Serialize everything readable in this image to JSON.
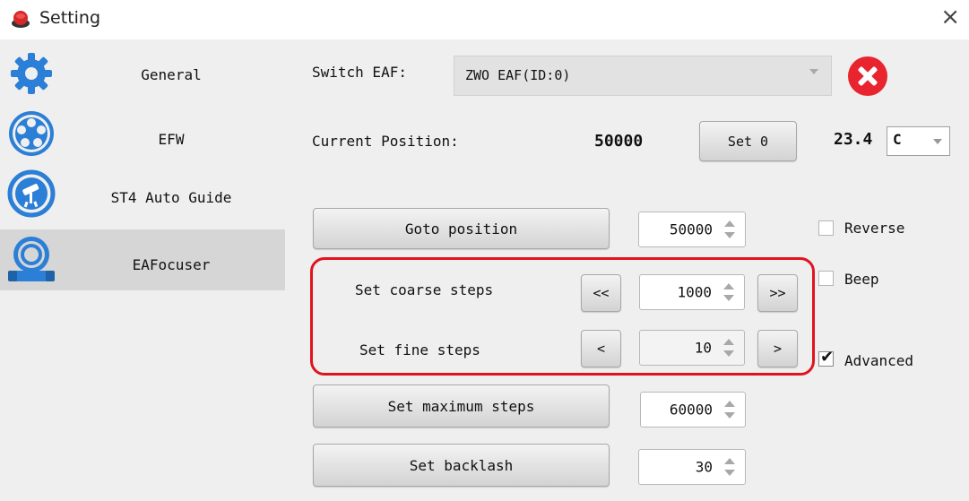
{
  "window": {
    "title": "Setting",
    "close_glyph": "×"
  },
  "sidebar": {
    "items": [
      {
        "label": "General",
        "icon": "gear-icon"
      },
      {
        "label": "EFW",
        "icon": "filter-wheel-icon"
      },
      {
        "label": "ST4 Auto Guide",
        "icon": "telescope-icon"
      },
      {
        "label": "EAFocuser",
        "icon": "focuser-icon",
        "active": true
      }
    ]
  },
  "eaf": {
    "switch_label": "Switch EAF:",
    "device_value": "ZWO EAF(ID:0)",
    "current_position_label": "Current Position:",
    "current_position_value": "50000",
    "set0_label": "Set 0",
    "temperature_value": "23.4",
    "temperature_unit": "C",
    "goto_label": "Goto position",
    "goto_value": "50000",
    "coarse_label": "Set coarse steps",
    "coarse_dec": "<<",
    "coarse_value": "1000",
    "coarse_inc": ">>",
    "fine_label": "Set fine steps",
    "fine_dec": "<",
    "fine_value": "10",
    "fine_inc": ">",
    "max_label": "Set maximum steps",
    "max_value": "60000",
    "backlash_label": "Set backlash",
    "backlash_value": "30",
    "reverse_label": "Reverse",
    "reverse_checked": false,
    "beep_label": "Beep",
    "beep_checked": false,
    "advanced_label": "Advanced",
    "advanced_checked": true,
    "check_glyph": "✔"
  },
  "colors": {
    "highlight": "#e0141e",
    "delete_button": "#e8242f",
    "active_sidebar": "#d6d6d6"
  }
}
